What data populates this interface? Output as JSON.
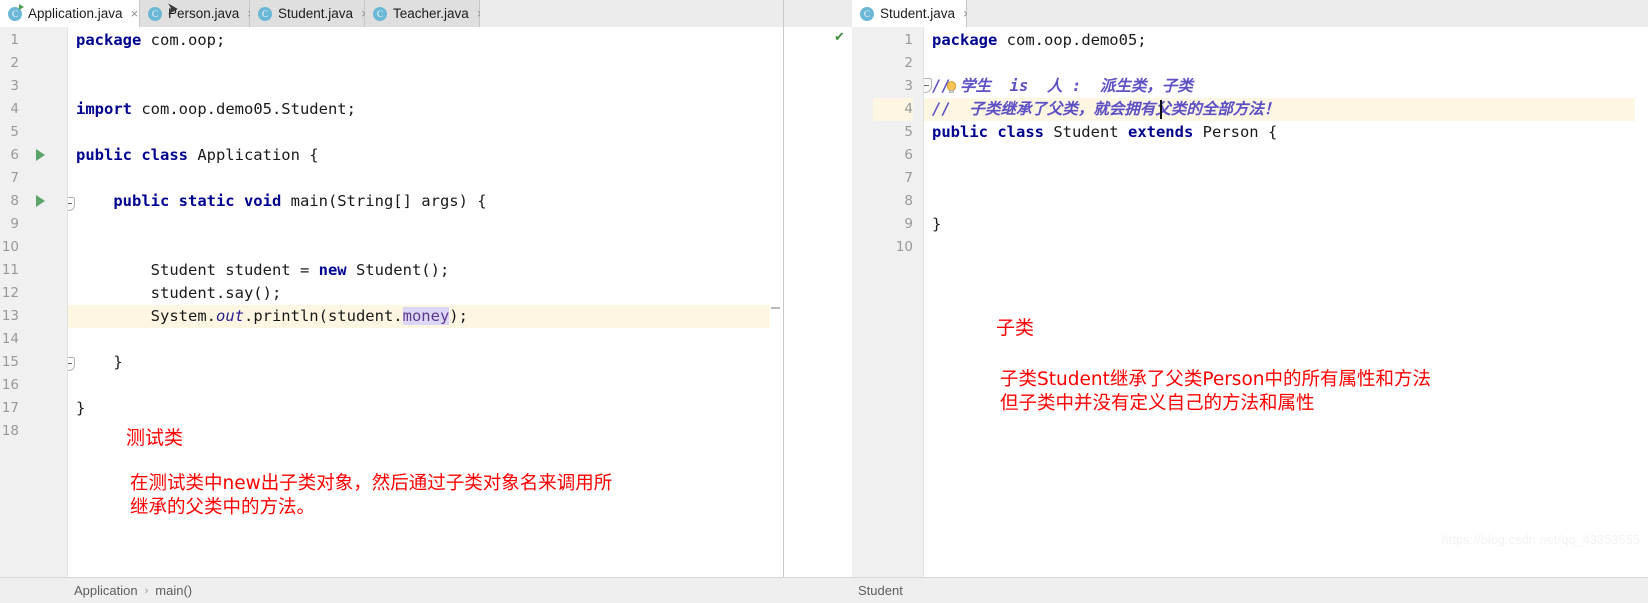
{
  "window": {
    "watermark": "https://blog.csdn.net/qq_43353555"
  },
  "left_editor": {
    "tabs": [
      {
        "label": "Application.java",
        "icon": "java-class-run-icon",
        "active": true,
        "close": "×"
      },
      {
        "label": "Person.java",
        "icon": "java-class-icon",
        "active": false,
        "close": "×"
      },
      {
        "label": "Student.java",
        "icon": "java-class-icon",
        "active": false,
        "close": "×"
      },
      {
        "label": "Teacher.java",
        "icon": "java-class-icon",
        "active": false,
        "close": "×"
      }
    ],
    "line_numbers": [
      "1",
      "2",
      "3",
      "4",
      "5",
      "6",
      "7",
      "8",
      "9",
      "10",
      "11",
      "12",
      "13",
      "14",
      "15",
      "16",
      "17",
      "18"
    ],
    "caret_line": 13,
    "run_markers": [
      6,
      8
    ],
    "code": [
      {
        "n": 1,
        "text": "package com.oop;",
        "tokens": [
          {
            "t": "package",
            "c": "kw"
          },
          {
            "t": " com.oop;",
            "c": ""
          }
        ]
      },
      {
        "n": 2,
        "text": ""
      },
      {
        "n": 3,
        "text": ""
      },
      {
        "n": 4,
        "text": "import com.oop.demo05.Student;",
        "tokens": [
          {
            "t": "import",
            "c": "kw"
          },
          {
            "t": " com.oop.demo05.Student;",
            "c": ""
          }
        ]
      },
      {
        "n": 5,
        "text": ""
      },
      {
        "n": 6,
        "text": "public class Application {",
        "tokens": [
          {
            "t": "public class",
            "c": "kw"
          },
          {
            "t": " Application {",
            "c": ""
          }
        ]
      },
      {
        "n": 7,
        "text": ""
      },
      {
        "n": 8,
        "text": "    public static void main(String[] args) {",
        "tokens": [
          {
            "t": "    ",
            "c": ""
          },
          {
            "t": "public static void",
            "c": "kw"
          },
          {
            "t": " main(String[] args) {",
            "c": ""
          }
        ]
      },
      {
        "n": 9,
        "text": ""
      },
      {
        "n": 10,
        "text": ""
      },
      {
        "n": 11,
        "text": "        Student student = new Student();",
        "tokens": [
          {
            "t": "        Student student = ",
            "c": ""
          },
          {
            "t": "new",
            "c": "kw"
          },
          {
            "t": " Student();",
            "c": ""
          }
        ]
      },
      {
        "n": 12,
        "text": "        student.say();",
        "tokens": [
          {
            "t": "        student.say();",
            "c": ""
          }
        ]
      },
      {
        "n": 13,
        "text": "        System.out.println(student.money);",
        "tokens": [
          {
            "t": "        System.",
            "c": ""
          },
          {
            "t": "out",
            "c": "fld"
          },
          {
            "t": ".println(student.",
            "c": ""
          },
          {
            "t": "money",
            "c": "hl"
          },
          {
            "t": ");",
            "c": ""
          }
        ]
      },
      {
        "n": 14,
        "text": ""
      },
      {
        "n": 15,
        "text": "    }",
        "tokens": [
          {
            "t": "    }",
            "c": ""
          }
        ]
      },
      {
        "n": 16,
        "text": ""
      },
      {
        "n": 17,
        "text": "}",
        "tokens": [
          {
            "t": "}",
            "c": ""
          }
        ]
      },
      {
        "n": 18,
        "text": ""
      }
    ],
    "annotations": {
      "title": "测试类",
      "body_line1": "在测试类中new出子类对象，然后通过子类对象名来调用所",
      "body_line2": "继承的父类中的方法。"
    },
    "status": {
      "crumb1": "Application",
      "sep": "›",
      "crumb2": "main()"
    }
  },
  "right_editor": {
    "tabs": [
      {
        "label": "Student.java",
        "icon": "java-class-icon",
        "active": true,
        "close": "×"
      }
    ],
    "line_numbers": [
      "1",
      "2",
      "3",
      "4",
      "5",
      "6",
      "7",
      "8",
      "9",
      "10"
    ],
    "caret_line": 4,
    "code": [
      {
        "n": 1,
        "text": "package com.oop.demo05;",
        "tokens": [
          {
            "t": "package",
            "c": "kw"
          },
          {
            "t": " com.oop.demo05;",
            "c": ""
          }
        ]
      },
      {
        "n": 2,
        "text": ""
      },
      {
        "n": 3,
        "text": "// 学生  is  人 :  派生类，子类",
        "tokens": [
          {
            "t": "// 学生  is  人 :  派生类，子类",
            "c": "cmt"
          }
        ]
      },
      {
        "n": 4,
        "text": "//  子类继承了父类，就会拥有父类的全部方法！",
        "tokens": [
          {
            "t": "//  子类继承了父类，就会拥有父类的全部方法！",
            "c": "cmt"
          }
        ]
      },
      {
        "n": 5,
        "text": "public class Student extends Person {",
        "tokens": [
          {
            "t": "public class",
            "c": "kw"
          },
          {
            "t": " Student ",
            "c": ""
          },
          {
            "t": "extends",
            "c": "kw"
          },
          {
            "t": " Person {",
            "c": ""
          }
        ]
      },
      {
        "n": 6,
        "text": ""
      },
      {
        "n": 7,
        "text": ""
      },
      {
        "n": 8,
        "text": ""
      },
      {
        "n": 9,
        "text": "}",
        "tokens": [
          {
            "t": "}",
            "c": ""
          }
        ]
      },
      {
        "n": 10,
        "text": ""
      }
    ],
    "annotations": {
      "title": "子类",
      "body_line1": "子类Student继承了父类Person中的所有属性和方法",
      "body_line2": "但子类中并没有定义自己的方法和属性"
    },
    "status": {
      "crumb1": "Student"
    },
    "inspection_ok": "✔"
  }
}
